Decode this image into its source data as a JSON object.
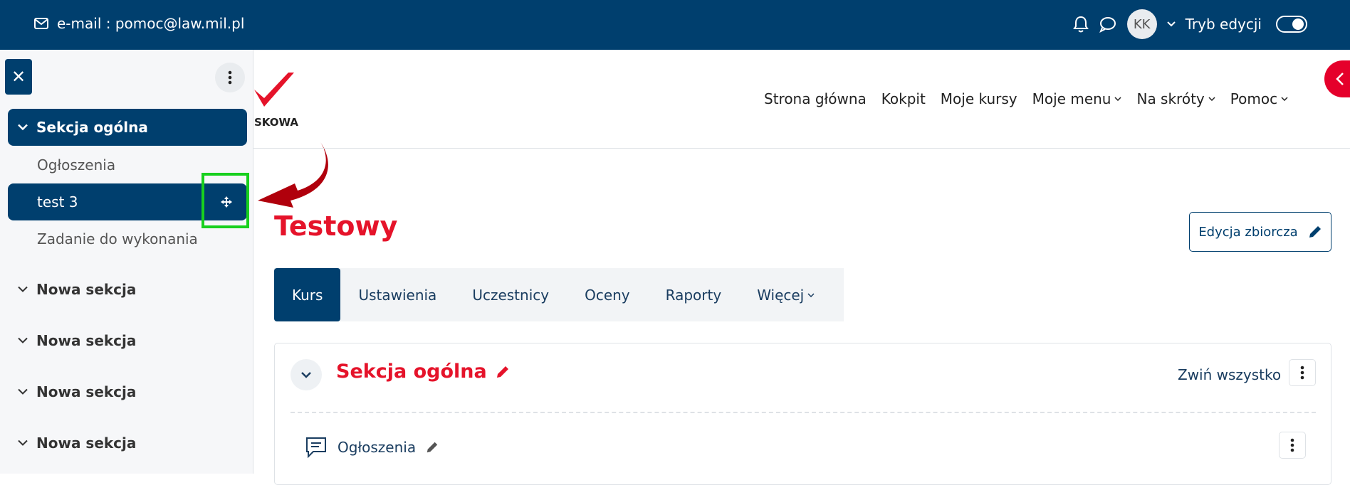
{
  "topbar": {
    "email": "e-mail : pomoc@law.mil.pl",
    "avatar": "KK",
    "edit_mode": "Tryb edycji",
    "icons": [
      "envelope-icon",
      "bell-icon",
      "chat-icon",
      "chevron-down-icon"
    ]
  },
  "drawer": {
    "sections": [
      {
        "title": "Sekcja ogólna",
        "items": [
          "Ogłoszenia",
          "test 3",
          "Zadanie do wykonania"
        ]
      },
      {
        "title": "Nowa sekcja"
      },
      {
        "title": "Nowa sekcja"
      },
      {
        "title": "Nowa sekcja"
      },
      {
        "title": "Nowa sekcja"
      }
    ]
  },
  "logo": {
    "text": "SKOWA"
  },
  "nav": {
    "items": [
      "Strona główna",
      "Kokpit",
      "Moje kursy",
      "Moje menu",
      "Na skróty",
      "Pomoc"
    ]
  },
  "course": {
    "title": "Testowy",
    "bulk_edit": "Edycja zbiorcza",
    "tabs": [
      "Kurs",
      "Ustawienia",
      "Uczestnicy",
      "Oceny",
      "Raporty",
      "Więcej"
    ],
    "section": {
      "title": "Sekcja ogólna",
      "collapse_all": "Zwiń wszystko"
    },
    "activity": "Ogłoszenia"
  },
  "colors": {
    "brand": "#003f6e",
    "accent": "#e5132a",
    "highlight": "#18d01e"
  }
}
